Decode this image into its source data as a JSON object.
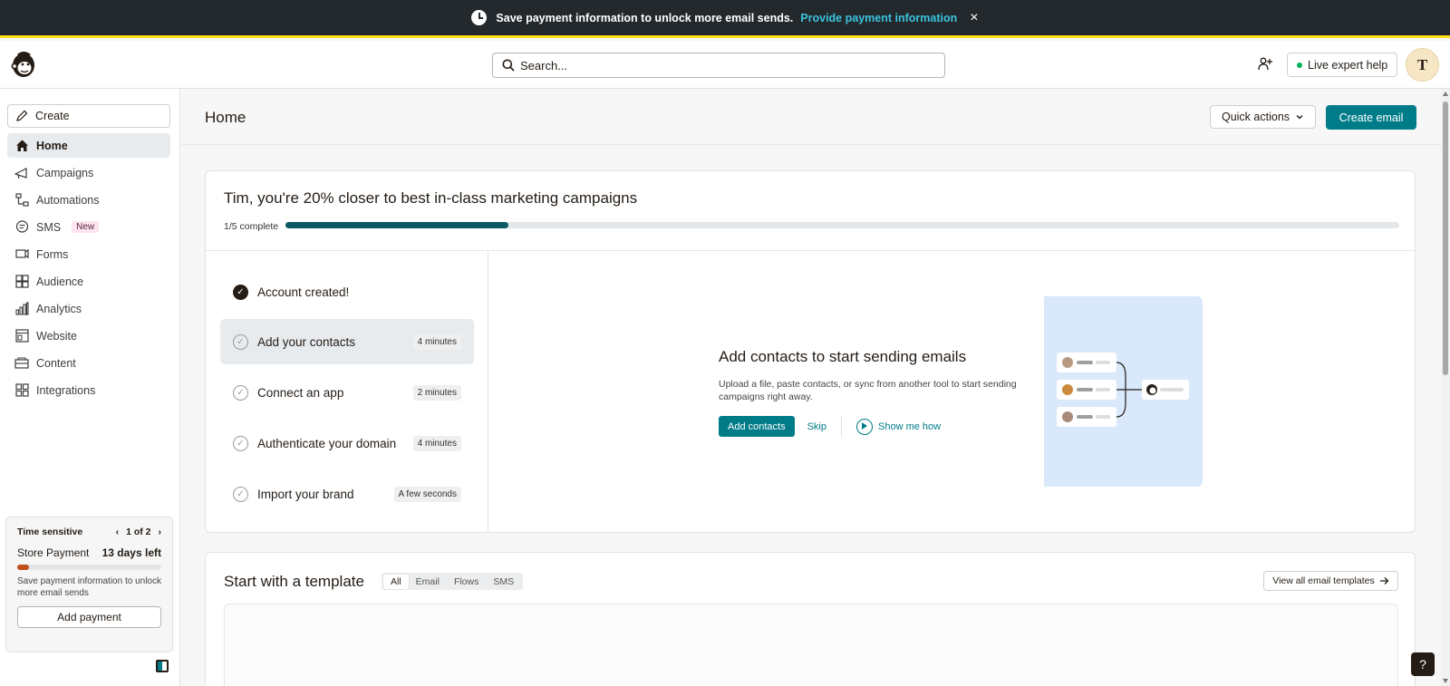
{
  "banner": {
    "message": "Save payment information to unlock more email sends.",
    "link": "Provide payment information",
    "close": "×"
  },
  "header": {
    "search_placeholder": "Search...",
    "live_help": "Live expert help",
    "avatar_initial": "T"
  },
  "sidebar": {
    "create": "Create",
    "items": [
      {
        "label": "Home",
        "icon": "home-icon",
        "active": true
      },
      {
        "label": "Campaigns",
        "icon": "megaphone-icon"
      },
      {
        "label": "Automations",
        "icon": "automation-icon"
      },
      {
        "label": "SMS",
        "icon": "sms-icon",
        "badge": "New"
      },
      {
        "label": "Forms",
        "icon": "forms-icon"
      },
      {
        "label": "Audience",
        "icon": "audience-icon"
      },
      {
        "label": "Analytics",
        "icon": "analytics-icon"
      },
      {
        "label": "Website",
        "icon": "website-icon"
      },
      {
        "label": "Content",
        "icon": "content-icon"
      },
      {
        "label": "Integrations",
        "icon": "integrations-icon"
      }
    ],
    "time_sensitive": {
      "heading": "Time sensitive",
      "pager": "1 of 2",
      "prev": "‹",
      "next": "›",
      "title": "Store Payment",
      "days_left": "13 days left",
      "progress": 0.08,
      "description": "Save payment information to unlock more email sends",
      "button": "Add payment"
    }
  },
  "page": {
    "title": "Home",
    "quick_actions": "Quick actions",
    "create_email": "Create email"
  },
  "onboarding": {
    "title": "Tim, you're 20% closer to best in-class marketing campaigns",
    "progress_label": "1/5 complete",
    "progress": 0.2,
    "steps": [
      {
        "label": "Account created!",
        "done": true,
        "time": ""
      },
      {
        "label": "Add your contacts",
        "done": false,
        "time": "4 minutes",
        "active": true
      },
      {
        "label": "Connect an app",
        "done": false,
        "time": "2 minutes"
      },
      {
        "label": "Authenticate your domain",
        "done": false,
        "time": "4 minutes"
      },
      {
        "label": "Import your brand",
        "done": false,
        "time": "A few seconds"
      }
    ],
    "detail": {
      "title": "Add contacts to start sending emails",
      "description": "Upload a file, paste contacts, or sync from another tool to start sending campaigns right away.",
      "primary": "Add contacts",
      "skip": "Skip",
      "show_me": "Show me how"
    }
  },
  "templates": {
    "title": "Start with a template",
    "tabs": [
      "All",
      "Email",
      "Flows",
      "SMS"
    ],
    "active_tab": "All",
    "view_all": "View all email templates"
  },
  "help": "?",
  "colors": {
    "accent": "#007c89",
    "banner_bg": "#23282c",
    "banner_stripe": "#ffe01b",
    "progress_fill": "#0b5a63",
    "urgent": "#c0501a"
  }
}
